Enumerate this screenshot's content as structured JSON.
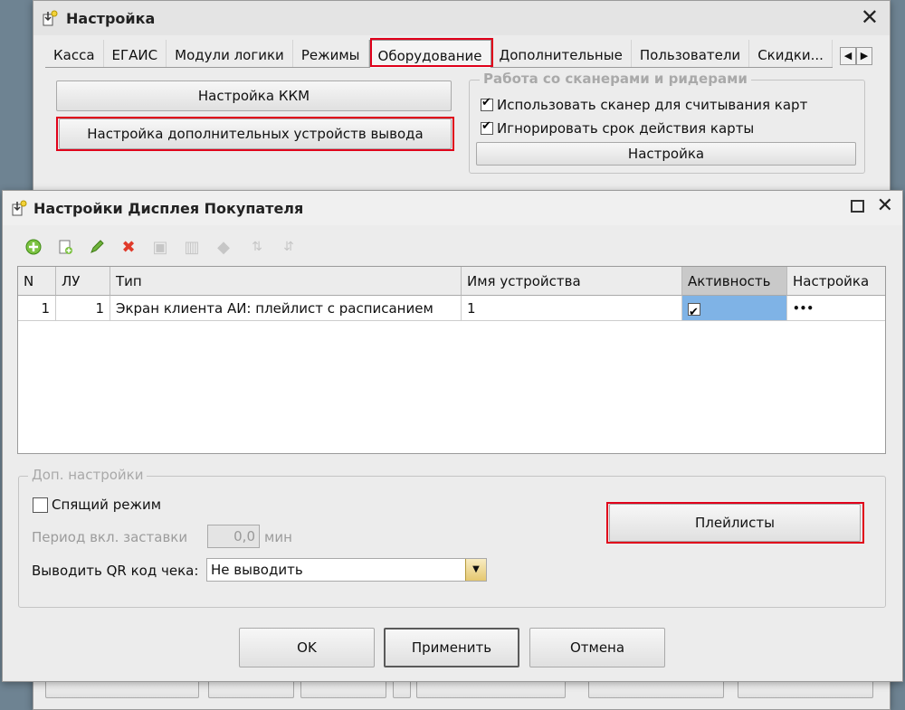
{
  "outer": {
    "title": "Настройка",
    "tabs": [
      "Касса",
      "ЕГАИС",
      "Модули логики",
      "Режимы",
      "Оборудование",
      "Дополнительные",
      "Пользователи",
      "Скидки..."
    ],
    "active_tab_index": 4,
    "kkm_button": "Настройка ККМ",
    "extra_devices_button": "Настройка дополнительных устройств вывода",
    "scanners_group": {
      "legend": "Работа со сканерами и ридерами",
      "use_scanner_label": "Использовать сканер для считывания карт",
      "use_scanner_checked": true,
      "ignore_expiry_label": "Игнорировать срок действия карты",
      "ignore_expiry_checked": true,
      "setup_button": "Настройка"
    }
  },
  "dialog": {
    "title": "Настройки Дисплея Покупателя",
    "columns": [
      "N",
      "ЛУ",
      "Тип",
      "Имя устройства",
      "Активность",
      "Настройка"
    ],
    "rows": [
      {
        "n": "1",
        "lu": "1",
        "type": "Экран клиента АИ: плейлист с расписанием",
        "device_name": "1",
        "active": true,
        "settings": "•••"
      }
    ],
    "extra_group": {
      "legend": "Доп. настройки",
      "sleep_mode_label": "Спящий режим",
      "sleep_mode_checked": false,
      "screensaver_label": "Период вкл. заставки",
      "screensaver_value": "0,0",
      "screensaver_unit": "мин",
      "qr_label": "Выводить QR код чека:",
      "qr_value": "Не выводить",
      "playlists_button": "Плейлисты"
    },
    "ok_button": "OK",
    "apply_button": "Применить",
    "cancel_button": "Отмена"
  },
  "colors": {
    "highlight": "#e0001a",
    "selected_cell": "#7fb3e6"
  }
}
